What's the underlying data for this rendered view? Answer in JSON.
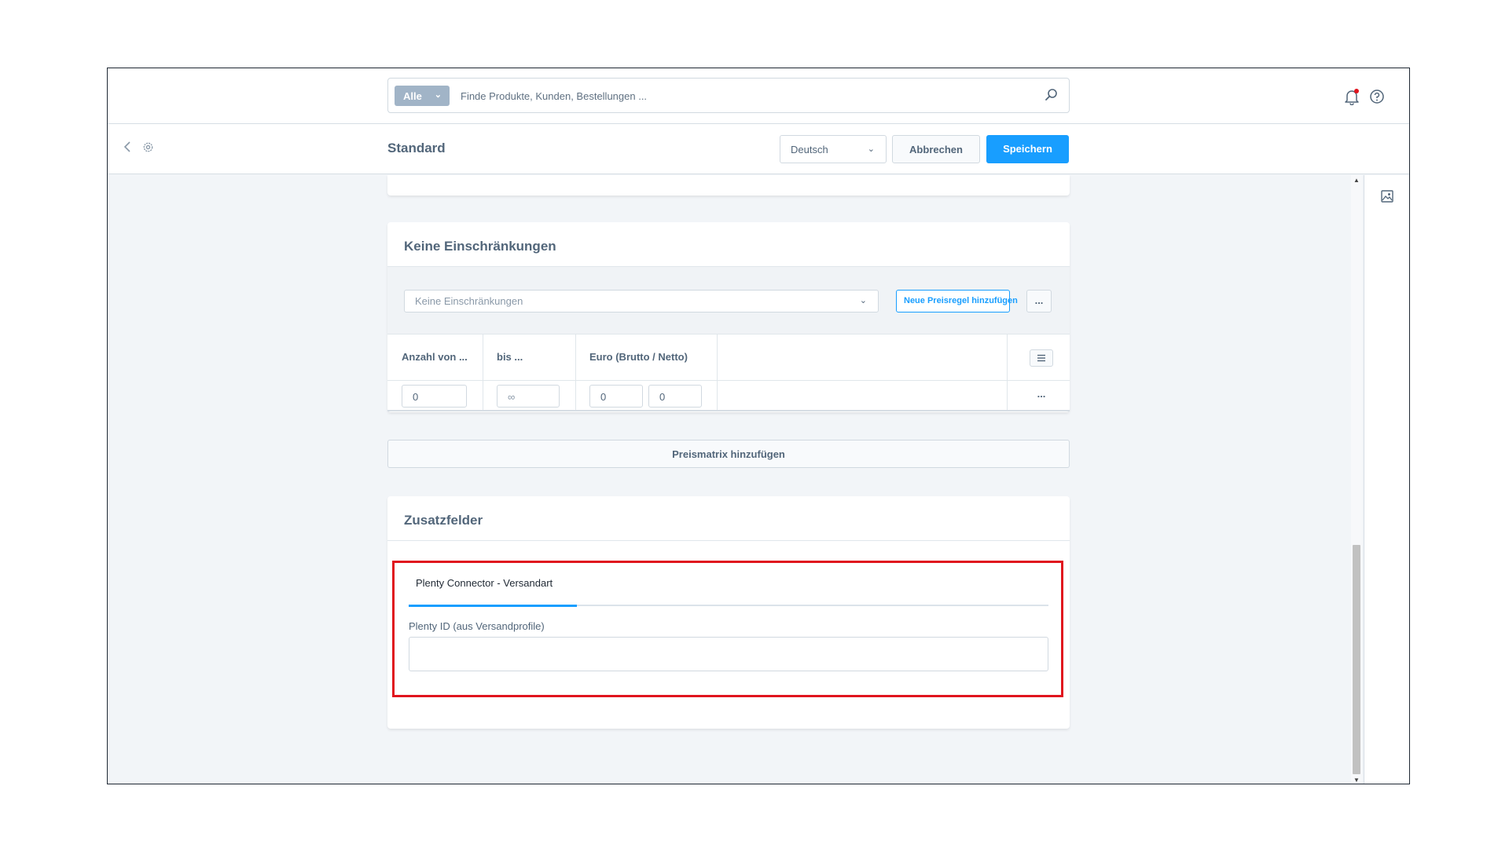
{
  "search": {
    "type_label": "Alle",
    "placeholder": "Finde Produkte, Kunden, Bestellungen ..."
  },
  "toolbar": {
    "title": "Standard",
    "language": "Deutsch",
    "cancel_label": "Abbrechen",
    "save_label": "Speichern"
  },
  "restrictions": {
    "title": "Keine Einschränkungen",
    "select_value": "Keine Einschränkungen",
    "add_rule_label": "Neue Preisregel hinzufügen",
    "more_label": "...",
    "table": {
      "headers": [
        "Anzahl von ...",
        "bis ...",
        "Euro (Brutto / Netto)"
      ],
      "row": {
        "from": "0",
        "to": "∞",
        "gross": "0",
        "net": "0",
        "more": "..."
      }
    }
  },
  "add_matrix_label": "Preismatrix hinzufügen",
  "extra_fields": {
    "title": "Zusatzfelder",
    "tab_label": "Plenty Connector - Versandart",
    "field_label": "Plenty ID (aus Versandprofile)",
    "field_value": ""
  },
  "colors": {
    "accent": "#189eff",
    "highlight": "#e0141e",
    "notification_dot": "#e0141e"
  },
  "icons": [
    "search-icon",
    "bell-icon",
    "help-icon",
    "back-icon",
    "gear-icon",
    "image-icon",
    "list-icon",
    "chevron-down-icon"
  ]
}
